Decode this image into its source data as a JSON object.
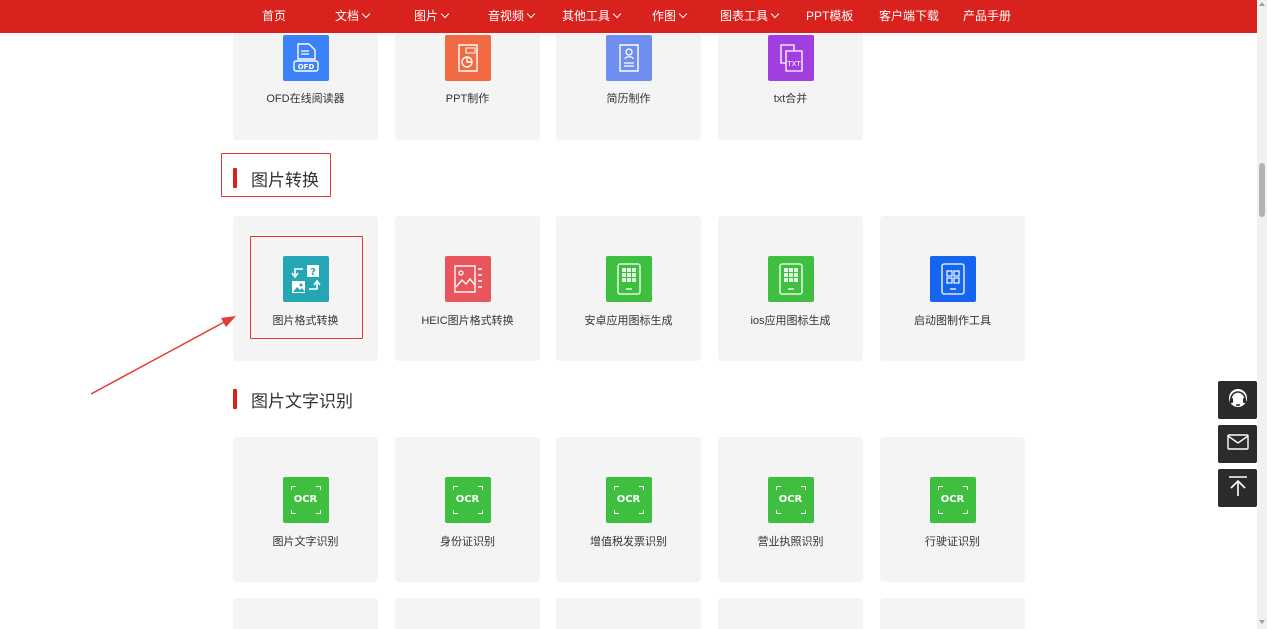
{
  "nav": {
    "items": [
      {
        "label": "首页",
        "has_dropdown": false
      },
      {
        "label": "文档",
        "has_dropdown": true
      },
      {
        "label": "图片",
        "has_dropdown": true
      },
      {
        "label": "音视频",
        "has_dropdown": true
      },
      {
        "label": "其他工具",
        "has_dropdown": true
      },
      {
        "label": "作图",
        "has_dropdown": true
      },
      {
        "label": "图表工具",
        "has_dropdown": true
      },
      {
        "label": "PPT模板",
        "has_dropdown": false
      },
      {
        "label": "客户端下载",
        "has_dropdown": false
      },
      {
        "label": "产品手册",
        "has_dropdown": false
      }
    ],
    "color": "#d9221e"
  },
  "top_tools": [
    {
      "label": "OFD在线阅读器",
      "icon": "ofd-document-icon",
      "color": "#3b82f6"
    },
    {
      "label": "PPT制作",
      "icon": "ppt-chart-icon",
      "color": "#f06a43"
    },
    {
      "label": "简历制作",
      "icon": "resume-icon",
      "color": "#6f8ff0"
    },
    {
      "label": "txt合并",
      "icon": "txt-merge-icon",
      "color": "#a13ee0"
    }
  ],
  "image_convert": {
    "title": "图片转换",
    "tools": [
      {
        "label": "图片格式转换",
        "icon": "image-format-convert-icon",
        "color": "#25a6b4",
        "highlighted": true
      },
      {
        "label": "HEIC图片格式转换",
        "icon": "heic-image-icon",
        "color": "#e8555b"
      },
      {
        "label": "安卓应用图标生成",
        "icon": "android-icon-grid-icon",
        "color": "#3fbf3f"
      },
      {
        "label": "ios应用图标生成",
        "icon": "ios-icon-grid-icon",
        "color": "#3fbf3f"
      },
      {
        "label": "启动图制作工具",
        "icon": "launch-image-icon",
        "color": "#1565f0"
      }
    ]
  },
  "ocr": {
    "title": "图片文字识别",
    "icon_text": "OCR",
    "color": "#3fbf3f",
    "tools": [
      {
        "label": "图片文字识别"
      },
      {
        "label": "身份证识别"
      },
      {
        "label": "增值税发票识别"
      },
      {
        "label": "营业执照识别"
      },
      {
        "label": "行驶证识别"
      }
    ]
  },
  "float_tools": [
    {
      "icon": "customer-service-icon"
    },
    {
      "icon": "mail-icon"
    },
    {
      "icon": "back-to-top-icon"
    }
  ],
  "annotation": {
    "color": "#e33a33"
  }
}
